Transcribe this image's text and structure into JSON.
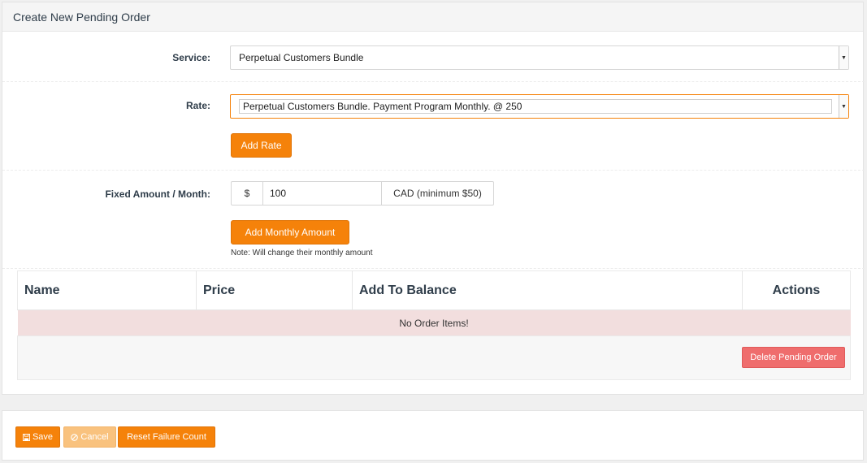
{
  "panel": {
    "title": "Create New Pending Order"
  },
  "form": {
    "service": {
      "label": "Service:",
      "value": "Perpetual Customers Bundle"
    },
    "rate": {
      "label": "Rate:",
      "value": "Perpetual Customers Bundle. Payment Program Monthly. @ 250",
      "add_button": "Add Rate"
    },
    "fixed_amount": {
      "label": "Fixed Amount / Month:",
      "currency_symbol": "$",
      "value": "100",
      "suffix": "CAD (minimum $50)",
      "add_button": "Add Monthly Amount",
      "note": "Note: Will change their monthly amount"
    }
  },
  "table": {
    "headers": [
      "Name",
      "Price",
      "Add To Balance",
      "Actions"
    ],
    "empty_message": "No Order Items!",
    "delete_button": "Delete Pending Order"
  },
  "actions": {
    "save": "Save",
    "cancel": "Cancel",
    "reset": "Reset Failure Count"
  },
  "icons": {
    "save": "floppy-disk-icon",
    "cancel": "ban-icon",
    "select_arrow": "caret-down-icon"
  },
  "colors": {
    "primary": "#f5820a",
    "danger": "#ef6d6d",
    "empty_row": "#f2dede"
  }
}
